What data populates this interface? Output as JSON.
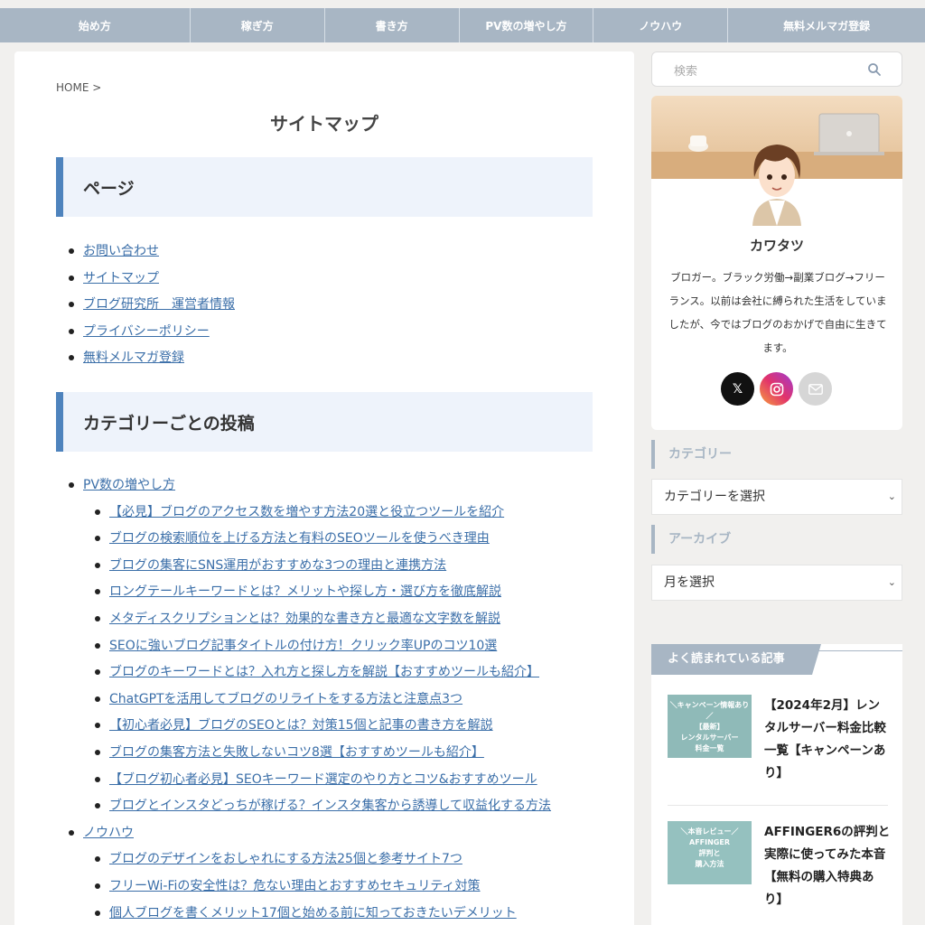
{
  "nav": [
    "始め方",
    "稼ぎ方",
    "書き方",
    "PV数の増やし方",
    "ノウハウ",
    "無料メルマガ登録"
  ],
  "breadcrumb": "HOME >",
  "page_title": "サイトマップ",
  "sections": {
    "pages_heading": "ページ",
    "pages": [
      "お問い合わせ",
      "サイトマップ",
      "ブログ研究所　運営者情報",
      "プライバシーポリシー",
      "無料メルマガ登録"
    ],
    "categories_heading": "カテゴリーごとの投稿"
  },
  "category_list": [
    {
      "label": "PV数の増やし方",
      "sub": false
    },
    {
      "label": "【必見】ブログのアクセス数を増やす方法20選と役立つツールを紹介",
      "sub": true
    },
    {
      "label": "ブログの検索順位を上げる方法と有料のSEOツールを使うべき理由",
      "sub": true
    },
    {
      "label": "ブログの集客にSNS運用がおすすめな3つの理由と連携方法",
      "sub": true
    },
    {
      "label": "ロングテールキーワードとは？メリットや探し方・選び方を徹底解説",
      "sub": true
    },
    {
      "label": "メタディスクリプションとは？効果的な書き方と最適な文字数を解説",
      "sub": true
    },
    {
      "label": "SEOに強いブログ記事タイトルの付け方！クリック率UPのコツ10選",
      "sub": true
    },
    {
      "label": "ブログのキーワードとは？入れ方と探し方を解説【おすすめツールも紹介】",
      "sub": true
    },
    {
      "label": "ChatGPTを活用してブログのリライトをする方法と注意点3つ",
      "sub": true
    },
    {
      "label": "【初心者必見】ブログのSEOとは？対策15個と記事の書き方を解説",
      "sub": true
    },
    {
      "label": "ブログの集客方法と失敗しないコツ8選【おすすめツールも紹介】",
      "sub": true
    },
    {
      "label": "【ブログ初心者必見】SEOキーワード選定のやり方とコツ&おすすめツール",
      "sub": true
    },
    {
      "label": "ブログとインスタどっちが稼げる？インスタ集客から誘導して収益化する方法",
      "sub": true
    },
    {
      "label": "ノウハウ",
      "sub": false
    },
    {
      "label": "ブログのデザインをおしゃれにする方法25個と参考サイト7つ",
      "sub": true
    },
    {
      "label": "フリーWi-Fiの安全性は？危ない理由とおすすめセキュリティ対策",
      "sub": true
    },
    {
      "label": "個人ブログを書くメリット17個と始める前に知っておきたいデメリット",
      "sub": true
    }
  ],
  "search": {
    "placeholder": "検索"
  },
  "profile": {
    "name": "カワタツ",
    "bio": "ブロガー。ブラック労働→副業ブログ→フリーランス。以前は会社に縛られた生活をしていましたが、今ではブログのおかげで自由に生きてます。",
    "social": [
      "x-icon",
      "instagram-icon",
      "mail-icon"
    ]
  },
  "widgets": {
    "category_title": "カテゴリー",
    "category_select": "カテゴリーを選択",
    "archive_title": "アーカイブ",
    "archive_select": "月を選択"
  },
  "popular": {
    "title": "よく読まれている記事",
    "items": [
      {
        "thumb": "＼キャンペーン情報あり／\n【最新】\nレンタルサーバー\n料金一覧",
        "title": "【2024年2月】レンタルサーバー料金比較一覧【キャンペーンあり】"
      },
      {
        "thumb": "＼本音レビュー／\nAFFINGER\n評判と\n購入方法",
        "title": "AFFINGER6の評判と実際に使ってみた本音【無料の購入特典あり】"
      }
    ]
  },
  "colors": {
    "nav": "#a8b6c4",
    "accent": "#4e83bd",
    "link": "#3a6ea8",
    "heading_bg": "#eef3fb"
  }
}
